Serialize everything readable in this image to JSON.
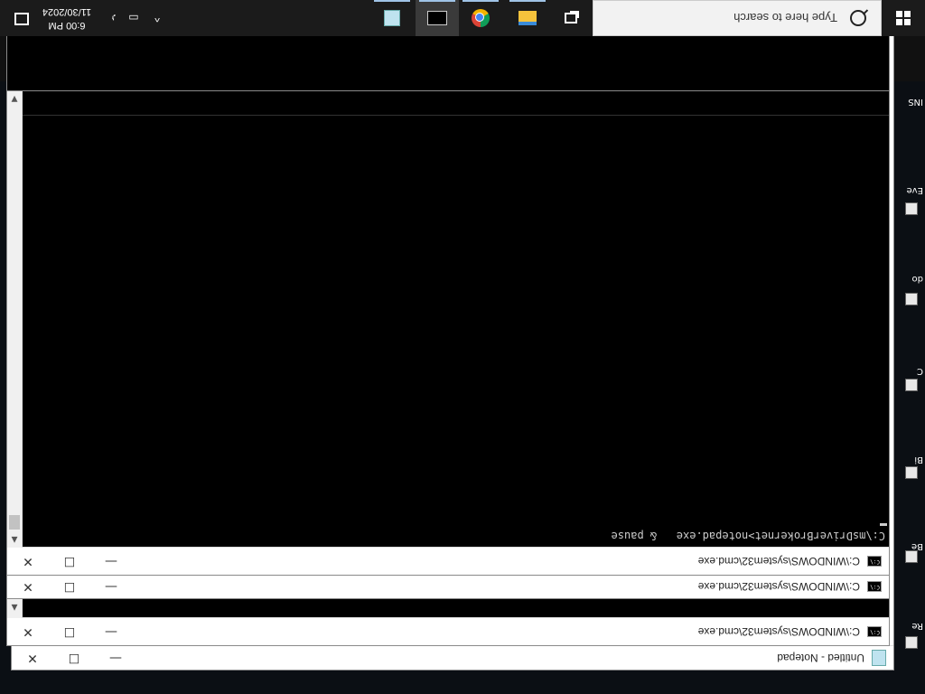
{
  "taskbar": {
    "search_placeholder": "Type here to search",
    "clock_time": "6:00 PM",
    "clock_date": "11/30/2024",
    "apps": [
      "task-view",
      "file-explorer",
      "chrome",
      "command-prompt",
      "notepad"
    ]
  },
  "desktop_icons": [
    {
      "label": "Re"
    },
    {
      "label": "Be"
    },
    {
      "label": "Bi"
    },
    {
      "label": "C"
    },
    {
      "label": "do"
    },
    {
      "label": "Eve"
    },
    {
      "label": "INS"
    }
  ],
  "windows": {
    "notepad_title": "Untitled - Notepad",
    "cmd1_title": "C:\\WINDOWS\\system32\\cmd.exe",
    "cmd2_title": "C:\\WINDOWS\\system32\\cmd.exe",
    "cmd3_title": "C:\\WINDOWS\\system32\\cmd.exe",
    "cmd3_console_line": "C:\\msDriverBrokernet>notepad.exe   & pause"
  },
  "controls": {
    "minimize": "—",
    "maximize": "☐",
    "close": "✕"
  },
  "colors": {
    "taskbar_bg": "#1b1b1b",
    "console_bg": "#000000",
    "titlebar_bg": "#ffffff",
    "accent": "#9fc3e6"
  }
}
